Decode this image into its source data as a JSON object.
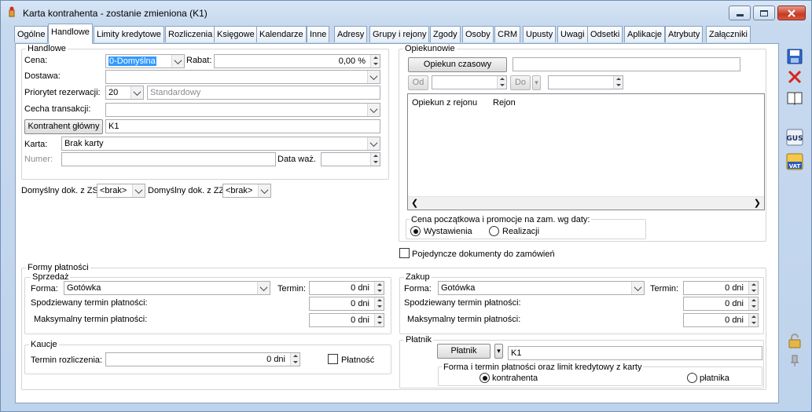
{
  "window": {
    "title": "Karta kontrahenta - zostanie zmieniona (K1)"
  },
  "tabs": [
    "Ogólne",
    "Handlowe",
    "Limity kredytowe",
    "Rozliczenia",
    "Księgowe",
    "Kalendarze",
    "Inne",
    "Adresy",
    "Grupy i rejony",
    "Zgody",
    "Osoby",
    "CRM",
    "Upusty",
    "Uwagi",
    "Odsetki",
    "Aplikacje",
    "Atrybuty",
    "Załączniki"
  ],
  "handlowe": {
    "group_label": "Handlowe",
    "cena_label": "Cena:",
    "cena_value": "0-Domyślna",
    "rabat_label": "Rabat:",
    "rabat_value": "0,00 %",
    "dostawa_label": "Dostawa:",
    "dostawa_value": "",
    "priorytet_label": "Priorytet rezerwacji:",
    "priorytet_value": "20",
    "priorytet_desc": "Standardowy",
    "cecha_label": "Cecha transakcji:",
    "cecha_value": "",
    "kontrahent_glowny_button": "Kontrahent główny",
    "kontrahent_glowny_value": "K1",
    "karta_label": "Karta:",
    "karta_value": "Brak karty",
    "numer_label": "Numer:",
    "numer_value": "",
    "data_waz_label": "Data waż.",
    "data_waz_value": ""
  },
  "domyslny": {
    "zs_label": "Domyślny dok. z ZS",
    "zs_value": "<brak>",
    "zz_label": "Domyślny dok. z ZZ",
    "zz_value": "<brak>"
  },
  "opiekunowie": {
    "group_label": "Opiekunowie",
    "opiekun_czasowy_button": "Opiekun czasowy",
    "opiekun_czasowy_value": "",
    "od_button": "Od",
    "od_value": "",
    "do_button": "Do",
    "do_value": "",
    "table_headers": [
      "Opiekun z rejonu",
      "Rejon"
    ]
  },
  "cena_poczatkowa": {
    "label": "Cena początkowa i promocje na zam. wg daty:",
    "option1": "Wystawienia",
    "option2": "Realizacji",
    "selected": "Wystawienia"
  },
  "pojedyncze": {
    "label": "Pojedyncze dokumenty do zamówień",
    "checked": false
  },
  "formy_platnosci": {
    "group_label": "Formy płatności",
    "sprzedaz": {
      "label": "Sprzedaż",
      "forma_label": "Forma:",
      "forma_value": "Gotówka",
      "termin_label": "Termin:",
      "termin_value": "0 dni",
      "spodziewany_label": "Spodziewany termin płatności:",
      "spodziewany_value": "0 dni",
      "maks_label": "Maksymalny termin płatności:",
      "maks_value": "0 dni"
    },
    "zakup": {
      "label": "Zakup",
      "forma_label": "Forma:",
      "forma_value": "Gotówka",
      "termin_label": "Termin:",
      "termin_value": "0 dni",
      "spodziewany_label": "Spodziewany termin płatności:",
      "spodziewany_value": "0 dni",
      "maks_label": "Maksymalny termin płatności:",
      "maks_value": "0 dni"
    }
  },
  "kaucje": {
    "label": "Kaucje",
    "termin_label": "Termin rozliczenia:",
    "termin_value": "0 dni",
    "platnosc_label": "Płatność",
    "platnosc_checked": false
  },
  "platnik": {
    "label": "Płatnik",
    "button": "Płatnik",
    "value": "K1",
    "sub_label": "Forma i termin płatności oraz limit kredytowy z karty",
    "option1": "kontrahenta",
    "option2": "płatnika",
    "selected": "kontrahenta"
  },
  "side_icons": [
    "save-icon",
    "close-icon",
    "book-icon",
    "gus-icon",
    "vat-icon",
    "lock-icon",
    "pin-icon"
  ]
}
